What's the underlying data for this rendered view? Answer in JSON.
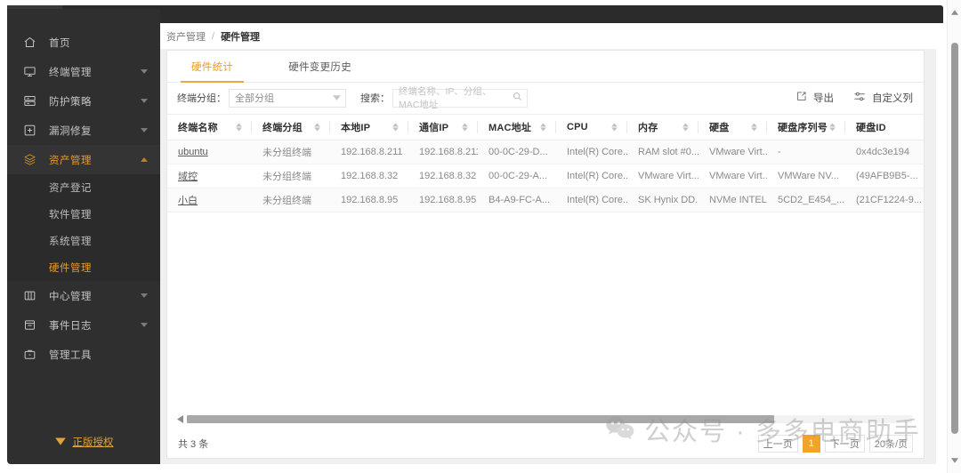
{
  "sidebar": {
    "items": [
      {
        "icon": "home-icon",
        "label": "首页",
        "hasCaret": false,
        "active": false
      },
      {
        "icon": "monitor-icon",
        "label": "终端管理",
        "hasCaret": true,
        "active": false
      },
      {
        "icon": "shield-icon",
        "label": "防护策略",
        "hasCaret": true,
        "active": false
      },
      {
        "icon": "patch-icon",
        "label": "漏洞修复",
        "hasCaret": true,
        "active": false
      },
      {
        "icon": "layers-icon",
        "label": "资产管理",
        "hasCaret": true,
        "active": true
      },
      {
        "icon": "dashboard-icon",
        "label": "中心管理",
        "hasCaret": true,
        "active": false
      },
      {
        "icon": "calendar-icon",
        "label": "事件日志",
        "hasCaret": true,
        "active": false
      },
      {
        "icon": "briefcase-icon",
        "label": "管理工具",
        "hasCaret": false,
        "active": false
      }
    ],
    "submenu": [
      {
        "label": "资产登记",
        "active": false
      },
      {
        "label": "软件管理",
        "active": false
      },
      {
        "label": "系统管理",
        "active": false
      },
      {
        "label": "硬件管理",
        "active": true
      }
    ],
    "license": {
      "icon": "gem-icon",
      "label": "正版授权"
    },
    "accent": "#e79c28",
    "background": "#2f2f2f"
  },
  "breadcrumb": {
    "parent": "资产管理",
    "separator": "/",
    "current": "硬件管理"
  },
  "tabs": [
    {
      "label": "硬件统计",
      "active": true
    },
    {
      "label": "硬件变更历史",
      "active": false
    }
  ],
  "filter": {
    "group_label": "终端分组：",
    "group_value": "全部分组",
    "search_label": "搜索：",
    "search_value": "",
    "search_placeholder": "终端名称、IP、分组、MAC地址",
    "search_icon": "search-icon"
  },
  "toolbar": {
    "export_label": "导出",
    "export_icon": "export-icon",
    "columns_label": "自定义列",
    "columns_icon": "sliders-icon"
  },
  "table": {
    "columns": [
      {
        "label": "终端名称",
        "sortable": true,
        "width": 95
      },
      {
        "label": "终端分组",
        "sortable": true,
        "width": 88
      },
      {
        "label": "本地IP",
        "sortable": true,
        "width": 88
      },
      {
        "label": "通信IP",
        "sortable": true,
        "width": 78
      },
      {
        "label": "MAC地址",
        "sortable": true,
        "width": 88
      },
      {
        "label": "CPU",
        "sortable": true,
        "width": 80
      },
      {
        "label": "内存",
        "sortable": true,
        "width": 80
      },
      {
        "label": "硬盘",
        "sortable": true,
        "width": 77
      },
      {
        "label": "硬盘序列号",
        "sortable": true,
        "width": 88
      },
      {
        "label": "硬盘ID",
        "sortable": false,
        "width": 90
      }
    ],
    "rows": [
      {
        "name": "ubuntu",
        "group": "未分组终端",
        "local_ip": "192.168.8.211",
        "comm_ip": "192.168.8.211",
        "mac": "00-0C-29-D...",
        "cpu": "Intel(R) Core...",
        "memory": "RAM slot #0...",
        "disk": "VMware Virt...",
        "disk_serial": "-",
        "disk_id": "0x4dc3e194"
      },
      {
        "name": "域控",
        "group": "未分组终端",
        "local_ip": "192.168.8.32",
        "comm_ip": "192.168.8.32",
        "mac": "00-0C-29-A...",
        "cpu": "Intel(R) Core...",
        "memory": "VMware Virt...",
        "disk": "VMware Virt...",
        "disk_serial": "VMWare NV...",
        "disk_id": "(49AFB9B5-..."
      },
      {
        "name": "小白",
        "group": "未分组终端",
        "local_ip": "192.168.8.95",
        "comm_ip": "192.168.8.95",
        "mac": "B4-A9-FC-A...",
        "cpu": "Intel(R) Core...",
        "memory": "SK Hynix DD...",
        "disk": "NVMe INTEL...",
        "disk_serial": "5CD2_E454_...",
        "disk_id": "(21CF1224-9..."
      }
    ]
  },
  "footer": {
    "total": "共 3 条",
    "prev_label": "上一页",
    "page_current": "1",
    "next_label": "下一页",
    "page_size": "20条/页"
  },
  "watermark": {
    "icon": "wechat-icon",
    "text": "公众号 · 多多电商助手"
  }
}
